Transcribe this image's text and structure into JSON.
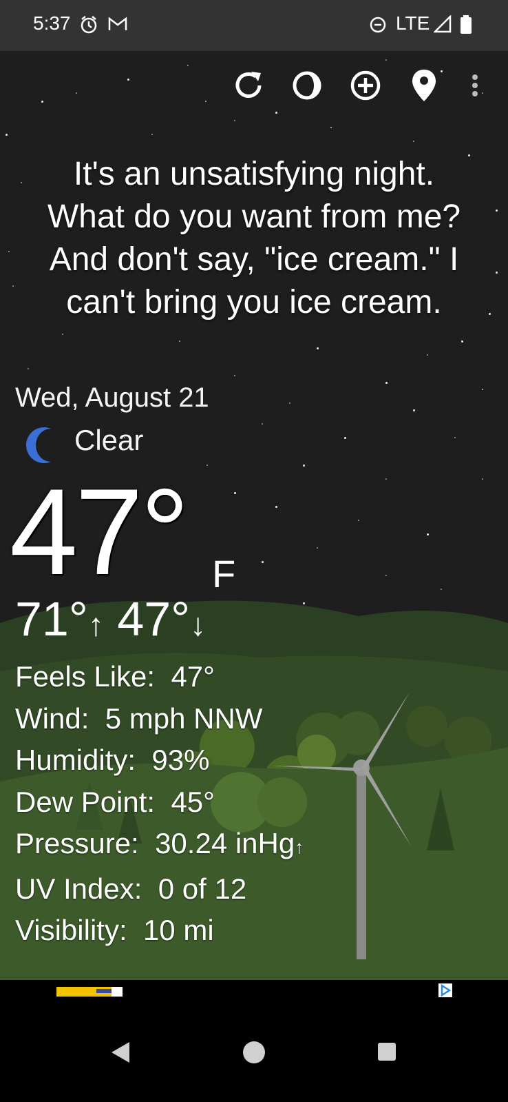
{
  "status_bar": {
    "time": "5:37",
    "network": "LTE",
    "icons": [
      "alarm-icon",
      "gmail-icon",
      "dnd-icon",
      "signal-icon",
      "battery-icon"
    ]
  },
  "toolbar": {
    "icons": [
      "refresh-icon",
      "moon-phase-icon",
      "add-location-icon",
      "location-pin-icon",
      "more-vert-icon"
    ]
  },
  "quote": {
    "line1": "It's an unsatisfying night.",
    "line2": "What do you want from me?",
    "line3": "And don't say, \"ice cream.\" I",
    "line4": "can't bring you ice cream."
  },
  "weather": {
    "date": "Wed, August 21",
    "condition": "Clear",
    "condition_icon": "crescent-moon-icon",
    "temperature": "47°",
    "unit": "F",
    "high": "71°",
    "low": "47°",
    "details": [
      {
        "label": "Feels Like:",
        "value": "47°"
      },
      {
        "label": "Wind:",
        "value": "5 mph NNW"
      },
      {
        "label": "Humidity:",
        "value": "93%"
      },
      {
        "label": "Dew Point:",
        "value": "45°"
      },
      {
        "label": "Pressure:",
        "value": "30.24 inHg"
      },
      {
        "label": "UV Index:",
        "value": "0 of 12"
      },
      {
        "label": "Visibility:",
        "value": "10 mi"
      }
    ]
  },
  "ad": {
    "icon": "ad-choices-icon"
  },
  "nav": {
    "icons": [
      "back-icon",
      "home-icon",
      "recents-icon"
    ]
  },
  "colors": {
    "status_bar_bg": "#333333",
    "sky_bg": "#1e1e1e",
    "hills": "#3f5a2a",
    "moon": "#3b6fd6"
  }
}
